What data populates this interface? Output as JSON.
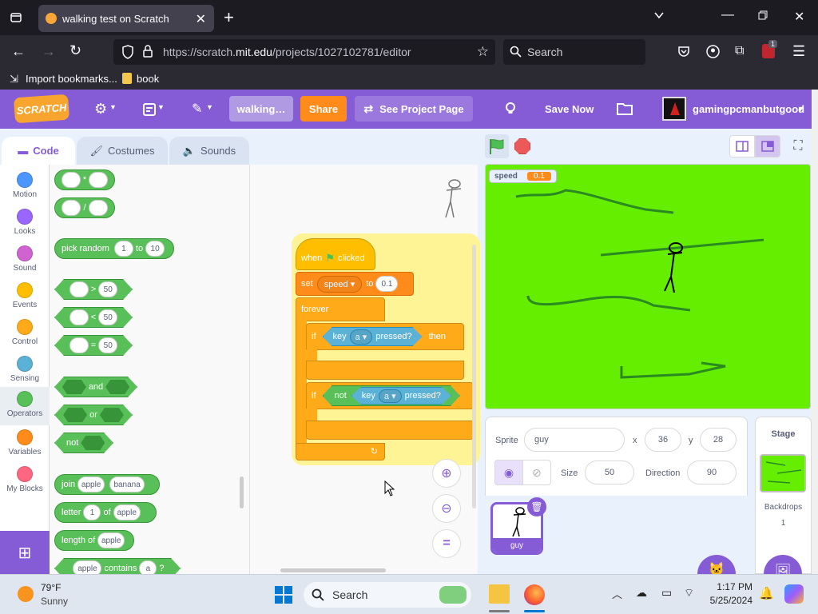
{
  "browser": {
    "tab_title": "walking test on Scratch",
    "url_prefix": "https://scratch.",
    "url_domain": "mit.edu",
    "url_path": "/projects/1027102781/editor",
    "search_placeholder": "Search",
    "extension_badge": "1",
    "bookmarks": [
      "Import bookmarks...",
      "book"
    ]
  },
  "scratch_menu": {
    "logo": "SCRATCH",
    "project_title": "walking…",
    "share": "Share",
    "see_project": "See Project Page",
    "save_now": "Save Now",
    "username": "gamingpcmanbutgood"
  },
  "editor_tabs": [
    "Code",
    "Costumes",
    "Sounds"
  ],
  "categories": [
    {
      "label": "Motion",
      "color": "#4c97ff"
    },
    {
      "label": "Looks",
      "color": "#9966ff"
    },
    {
      "label": "Sound",
      "color": "#cf63cf"
    },
    {
      "label": "Events",
      "color": "#ffbf00"
    },
    {
      "label": "Control",
      "color": "#ffab19"
    },
    {
      "label": "Sensing",
      "color": "#5cb1d6"
    },
    {
      "label": "Operators",
      "color": "#59c059"
    },
    {
      "label": "Variables",
      "color": "#ff8c1a"
    },
    {
      "label": "My Blocks",
      "color": "#ff6680"
    }
  ],
  "palette": {
    "op_mul": "*",
    "op_div": "/",
    "pick_random": "pick random",
    "to": "to",
    "rand_from": "1",
    "rand_to": "10",
    "gt": ">",
    "lt": "<",
    "eq": "=",
    "cmp_val": "50",
    "and": "and",
    "or": "or",
    "not": "not",
    "join": "join",
    "join_a": "apple",
    "join_b": "banana",
    "letter": "letter",
    "letter_n": "1",
    "of": "of",
    "letter_s": "apple",
    "length_of": "length of",
    "length_s": "apple",
    "contains_a": "apple",
    "contains": "contains",
    "contains_b": "a",
    "contains_q": "?"
  },
  "script": {
    "when": "when",
    "clicked": "clicked",
    "set": "set",
    "var": "speed",
    "to": "to",
    "value": "0.1",
    "forever": "forever",
    "if": "if",
    "key": "key",
    "key_a": "a",
    "pressed": "pressed?",
    "then": "then",
    "not": "not"
  },
  "stage": {
    "monitor_label": "speed",
    "monitor_value": "0.1"
  },
  "sprite_info": {
    "sprite_label": "Sprite",
    "sprite_name": "guy",
    "x_label": "x",
    "x": "36",
    "y_label": "y",
    "y": "28",
    "size_label": "Size",
    "size": "50",
    "direction_label": "Direction",
    "direction": "90",
    "thumb_name": "guy"
  },
  "stage_panel": {
    "title": "Stage",
    "backdrops_label": "Backdrops",
    "backdrops_count": "1"
  },
  "taskbar": {
    "temp": "79°F",
    "weather": "Sunny",
    "search": "Search",
    "time": "1:17 PM",
    "date": "5/25/2024"
  }
}
